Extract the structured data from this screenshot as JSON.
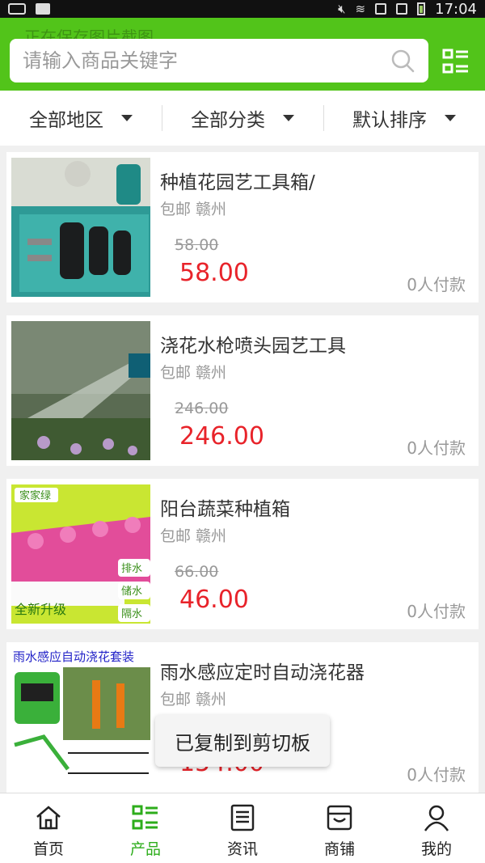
{
  "status_bar": {
    "time": "17:04"
  },
  "header": {
    "ghost_text": "正在保存图片截图",
    "search_placeholder": "请输入商品关键字"
  },
  "filters": [
    {
      "label": "全部地区"
    },
    {
      "label": "全部分类"
    },
    {
      "label": "默认排序"
    }
  ],
  "products": [
    {
      "title": "种植花园艺工具箱/",
      "meta": "包邮 赣州",
      "old_price": "58.00",
      "price": "58.00",
      "sold": "0人付款",
      "image": "garden-tool-set"
    },
    {
      "title": "浇花水枪喷头园艺工具",
      "meta": "包邮 赣州",
      "old_price": "246.00",
      "price": "246.00",
      "sold": "0人付款",
      "image": "water-spray-nozzle"
    },
    {
      "title": "阳台蔬菜种植箱",
      "meta": "包邮 赣州",
      "old_price": "66.00",
      "price": "46.00",
      "sold": "0人付款",
      "image": "balcony-planter-box",
      "image_text": {
        "brand": "家家绿",
        "b1": "排水",
        "b2": "储水",
        "b3": "隔水",
        "banner": "全新升级"
      }
    },
    {
      "title": "雨水感应定时自动浇花器",
      "meta": "包邮 赣州",
      "old_price": "",
      "price": "154.00",
      "sold": "0人付款",
      "image": "auto-watering-kit",
      "image_text": {
        "headline": "雨水感应自动浇花套装"
      }
    }
  ],
  "toast": "已复制到剪切板",
  "tabs": [
    {
      "label": "首页",
      "icon": "home-icon",
      "active": false
    },
    {
      "label": "产品",
      "icon": "product-list-icon",
      "active": true
    },
    {
      "label": "资讯",
      "icon": "news-icon",
      "active": false
    },
    {
      "label": "商铺",
      "icon": "store-icon",
      "active": false
    },
    {
      "label": "我的",
      "icon": "user-icon",
      "active": false
    }
  ],
  "colors": {
    "brand": "#52c41a",
    "price": "#e8232a",
    "active_tab": "#2dad1b"
  }
}
